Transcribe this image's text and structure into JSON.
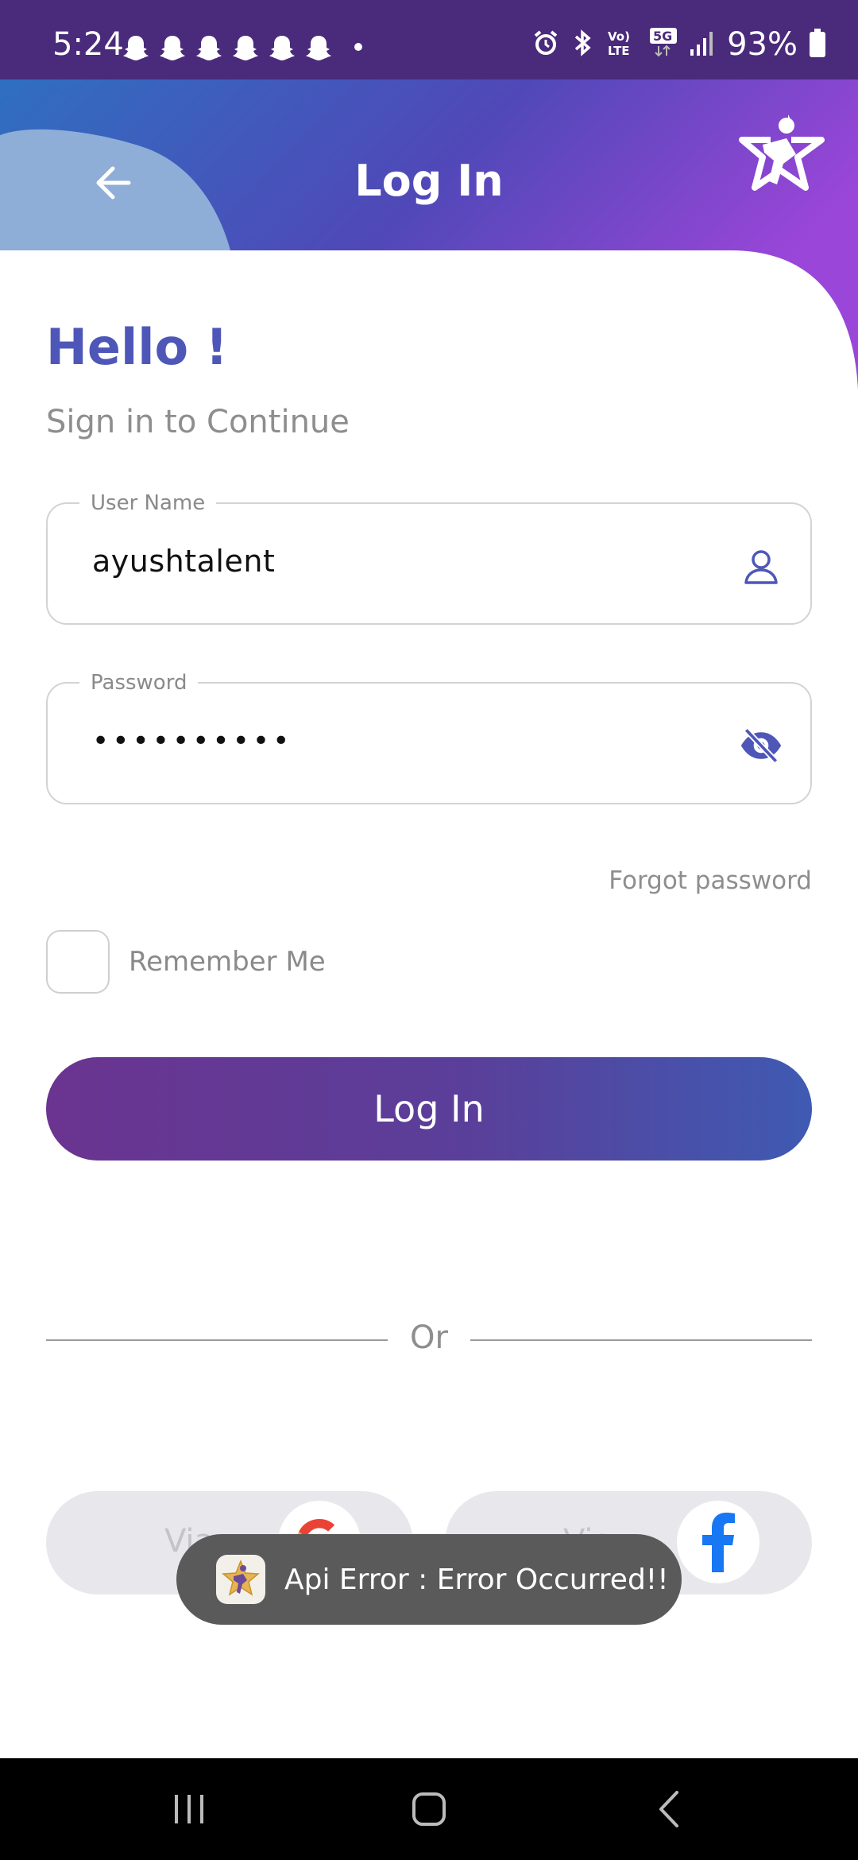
{
  "status_bar": {
    "time": "5:24",
    "battery_percent": "93%",
    "network": "5G",
    "volte": "Vo) LTE",
    "notification_icons": [
      "snapchat-icon",
      "snapchat-icon",
      "snapchat-icon",
      "snapchat-icon",
      "snapchat-icon",
      "snapchat-icon"
    ],
    "indicator_icons": [
      "alarm-icon",
      "bluetooth-icon",
      "volte-icon",
      "5g-icon",
      "signal-icon",
      "battery-icon"
    ]
  },
  "header": {
    "title": "Log In",
    "back_icon": "arrow-left-icon",
    "logo_icon": "star-person-logo-icon",
    "gradient_colors": [
      "#2f6fc0",
      "#5048b8",
      "#9a46d8"
    ]
  },
  "greeting": {
    "title": "Hello !",
    "subtitle": "Sign in to Continue"
  },
  "form": {
    "username": {
      "label": "User Name",
      "value": "ayushtalent",
      "icon": "user-icon"
    },
    "password": {
      "label": "Password",
      "value": "••••••••••",
      "icon": "eye-off-icon"
    },
    "forgot_password": "Forgot password",
    "remember_me": {
      "label": "Remember Me",
      "checked": false
    },
    "submit_label": "Log In"
  },
  "divider_text": "Or",
  "social": {
    "google": {
      "label": "Via",
      "icon": "google-icon"
    },
    "facebook": {
      "label": "Via",
      "icon": "facebook-icon"
    }
  },
  "toast": {
    "text": "Api Error : Error Occurred!!",
    "icon": "app-logo-icon"
  },
  "nav_bar": {
    "buttons": [
      "recents-icon",
      "home-icon",
      "back-icon"
    ]
  },
  "colors": {
    "accent": "#4e57b8",
    "button_gradient": [
      "#6a3490",
      "#3f5ab2"
    ],
    "status_bar": "#4a2a7a"
  }
}
